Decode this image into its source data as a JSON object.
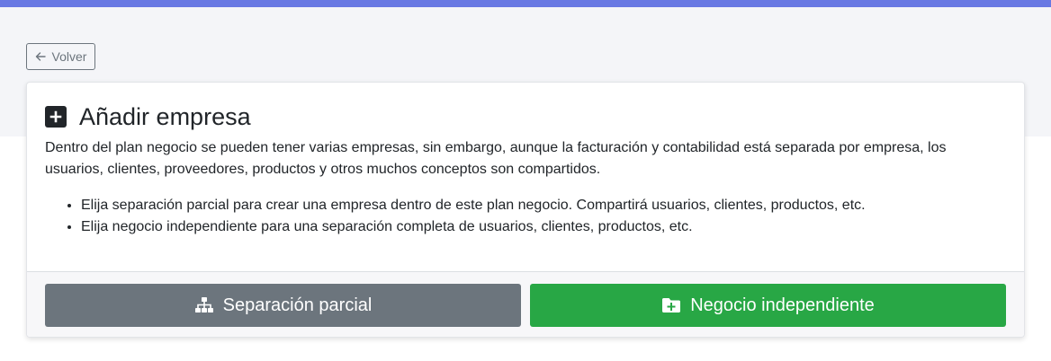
{
  "colors": {
    "top_bar": "#6878e3",
    "band": "#f4f5f8",
    "secondary": "#6c757d",
    "success": "#28a745",
    "text": "#212529"
  },
  "header": {
    "back_label": "Volver",
    "back_icon": "arrow-left-icon"
  },
  "card": {
    "title_icon": "plus-square-icon",
    "title": "Añadir empresa",
    "intro": "Dentro del plan negocio se pueden tener varias empresas, sin embargo, aunque la facturación y contabilidad está separada por empresa, los usuarios, clientes, proveedores, productos y otros muchos conceptos son compartidos.",
    "options": [
      "Elija separación parcial para crear una empresa dentro de este plan negocio. Compartirá usuarios, clientes, productos, etc.",
      "Elija negocio independiente para una separación completa de usuarios, clientes, productos, etc."
    ]
  },
  "actions": {
    "partial": {
      "label": "Separación parcial",
      "icon": "sitemap-icon"
    },
    "independent": {
      "label": "Negocio independiente",
      "icon": "folder-plus-icon"
    }
  }
}
